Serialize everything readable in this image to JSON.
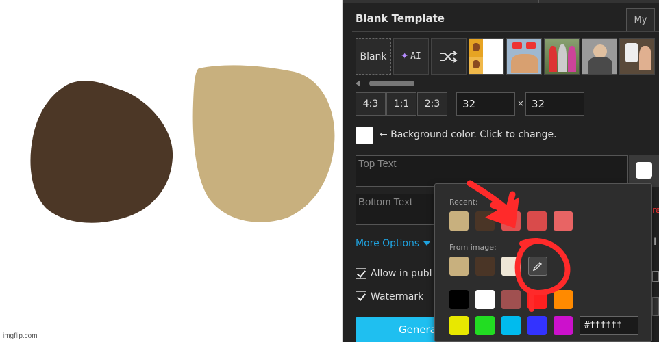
{
  "watermark": "imgflip.com",
  "panel": {
    "template_title": "Blank Template",
    "my_tab": "My",
    "tiles": {
      "blank": "Blank",
      "ai": "AI"
    },
    "ratios": [
      "4:3",
      "1:1",
      "2:3"
    ],
    "width": "32",
    "height": "32",
    "times": "×",
    "bg_label": "← Background color. Click to change.",
    "top_text_placeholder": "Top Text",
    "bottom_text_placeholder": "Bottom Text",
    "more_options": "More Options",
    "allow_public": "Allow in publ",
    "watermark_label": "Watermark",
    "generate": "Generate"
  },
  "picker": {
    "recent_label": "Recent:",
    "from_image_label": "From image:",
    "recent": [
      "#c8b07e",
      "#4a3526",
      "#e05050",
      "#d94b4b",
      "#e86464"
    ],
    "from_image": [
      "#c8b07e",
      "#4a3526",
      "#eee6d6"
    ],
    "palette_row1": [
      "#000000",
      "#ffffff",
      "#a05050",
      "#ff2020",
      "#ff8a00"
    ],
    "palette_row2": [
      "#e8e800",
      "#22dd22",
      "#00bbee",
      "#3333ff",
      "#cc11cc"
    ],
    "hex_value": "#ffffff"
  },
  "colors": {
    "dark_blob": "#4c3726",
    "light_blob": "#c8b07e",
    "annotation": "#ff2a2a",
    "accent": "#1fa3e0"
  }
}
